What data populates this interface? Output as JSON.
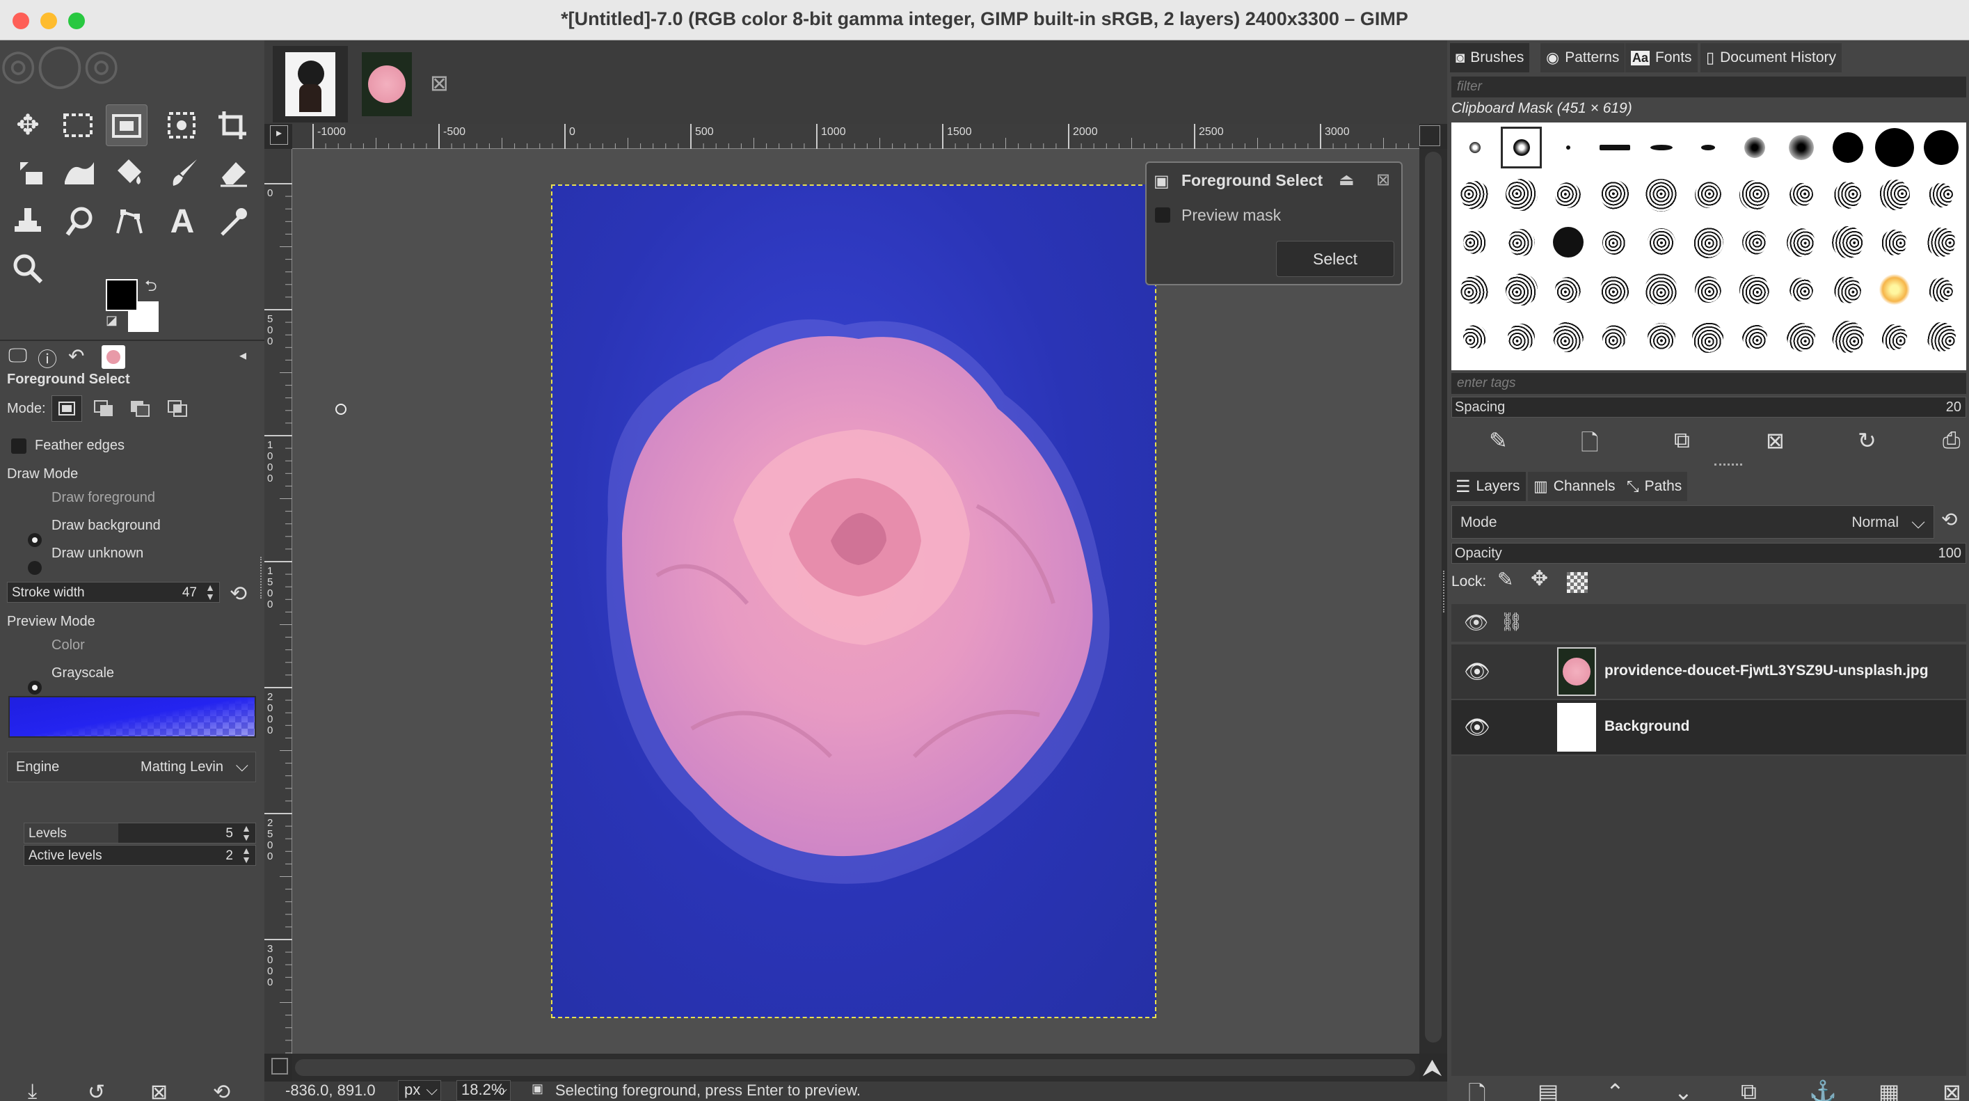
{
  "window": {
    "title": "*[Untitled]-7.0 (RGB color 8-bit gamma integer, GIMP built-in sRGB, 2 layers) 2400x3300 – GIMP"
  },
  "toolbox": {
    "tools": [
      "move-tool",
      "rect-select-tool",
      "foreground-select-tool",
      "fuzzy-select-tool",
      "crop-tool",
      "unified-transform-tool",
      "warp-tool",
      "bucket-fill-tool",
      "paintbrush-tool",
      "eraser-tool",
      "clone-tool",
      "smudge-tool",
      "paths-tool",
      "text-tool",
      "color-picker-tool",
      "zoom-tool"
    ],
    "fg_color": "#000000",
    "bg_color": "#ffffff"
  },
  "tool_options": {
    "title": "Foreground Select",
    "mode_label": "Mode:",
    "feather_edges": "Feather edges",
    "draw_mode_heading": "Draw Mode",
    "draw_modes": [
      "Draw foreground",
      "Draw background",
      "Draw unknown"
    ],
    "draw_mode_selected": "Draw foreground",
    "stroke_width_label": "Stroke width",
    "stroke_width_value": "47",
    "preview_mode_heading": "Preview Mode",
    "preview_modes": [
      "Color",
      "Grayscale"
    ],
    "preview_mode_selected": "Color",
    "engine_label": "Engine",
    "engine_value": "Matting Levin",
    "levels_label": "Levels",
    "levels_value": "5",
    "active_levels_label": "Active levels",
    "active_levels_value": "2"
  },
  "canvas": {
    "ruler_ticks": [
      "-1000",
      "-500",
      "0",
      "500",
      "1000",
      "1500",
      "2000",
      "2500",
      "3000"
    ],
    "ruler_left_ticks": [
      "0",
      "5\n0\n0",
      "1\n0\n0\n0",
      "1\n5\n0\n0",
      "2\n0\n0\n0",
      "2\n5\n0\n0",
      "3\n0\n0\n0"
    ],
    "status_coords": "-836.0, 891.0",
    "status_unit": "px",
    "status_zoom": "18.2%",
    "status_message": "Selecting foreground, press Enter to preview."
  },
  "fg_dialog": {
    "title": "Foreground Select",
    "preview_mask": "Preview mask",
    "select_button": "Select"
  },
  "brushes_dock": {
    "tabs": [
      "Brushes",
      "Patterns",
      "Fonts",
      "Document History"
    ],
    "filter_placeholder": "filter",
    "current_brush": "Clipboard Mask (451 × 619)",
    "tags_placeholder": "enter tags",
    "spacing_label": "Spacing",
    "spacing_value": "20"
  },
  "layers_dock": {
    "tabs": [
      "Layers",
      "Channels",
      "Paths"
    ],
    "mode_label": "Mode",
    "mode_value": "Normal",
    "opacity_label": "Opacity",
    "opacity_value": "100",
    "lock_label": "Lock:",
    "layers": [
      {
        "name": "providence-doucet-FjwtL3YSZ9U-unsplash.jpg",
        "visible": true
      },
      {
        "name": "Background",
        "visible": true
      }
    ]
  }
}
